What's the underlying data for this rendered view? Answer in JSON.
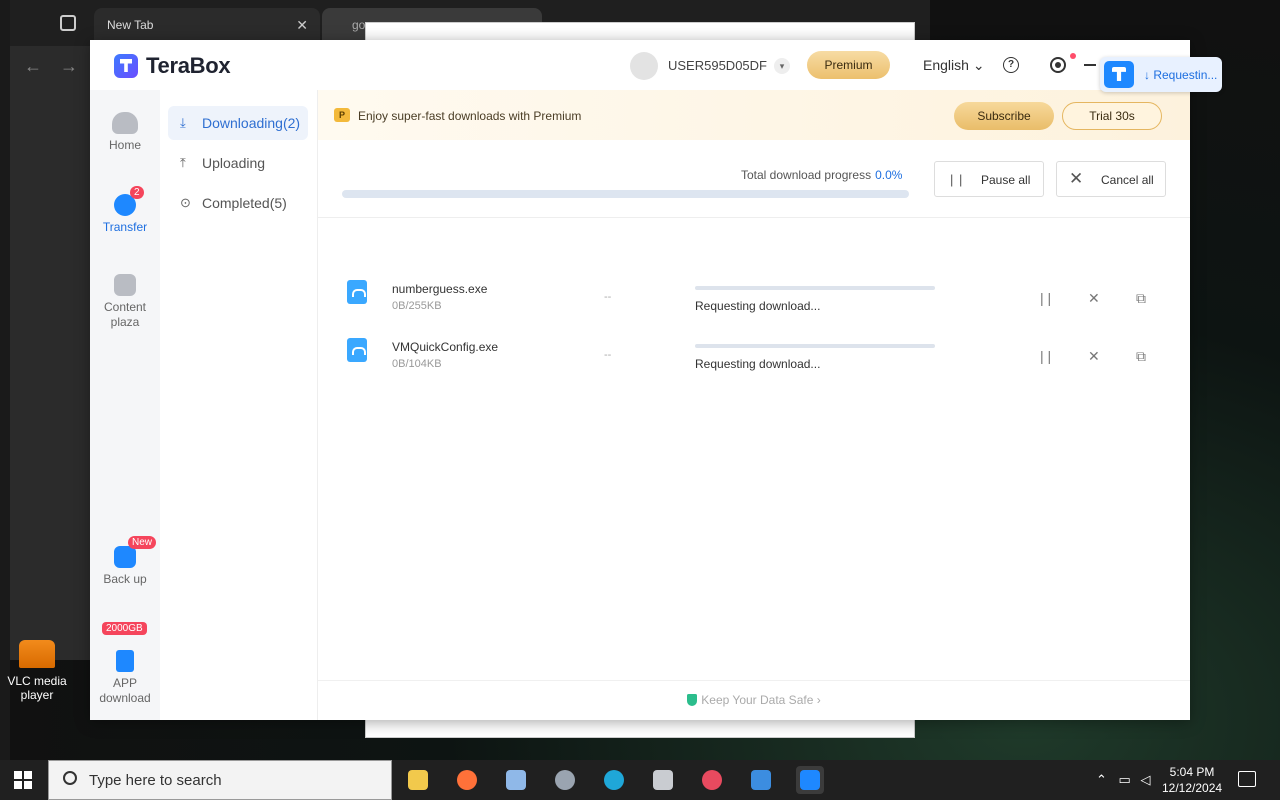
{
  "browser": {
    "tab_title": "New Tab",
    "tab2_title": "go",
    "nav_back": "←",
    "nav_forward": "→"
  },
  "desktop": {
    "vlc_label": "VLC media player"
  },
  "app": {
    "brand": "TeraBox",
    "username": "USER595D05DF",
    "premium_label": "Premium",
    "language": "English",
    "language_chevron": "⌄",
    "help_glyph": "?",
    "float_status": "↓ Requestin..."
  },
  "rail": {
    "items": [
      {
        "label": "Home",
        "icon": "cloud-icon"
      },
      {
        "label": "Transfer",
        "icon": "transfer-icon",
        "badge": "2"
      },
      {
        "label": "Content plaza",
        "icon": "play-icon"
      },
      {
        "label": "Back up",
        "icon": "backup-icon",
        "badge": "New"
      },
      {
        "label": "APP download",
        "icon": "phone-icon",
        "badge": "2000GB"
      }
    ]
  },
  "sidebar": {
    "items": [
      {
        "label": "Downloading(2)",
        "icon": "download-icon",
        "active": true
      },
      {
        "label": "Uploading",
        "icon": "upload-icon"
      },
      {
        "label": "Completed(5)",
        "icon": "check-circle-icon"
      }
    ]
  },
  "promo": {
    "text": "Enjoy super-fast downloads with Premium",
    "subscribe": "Subscribe",
    "trial": "Trial 30s"
  },
  "progress": {
    "label": "Total download progress",
    "value": "0.0%",
    "fraction": 0.0,
    "pause_all": "Pause all",
    "cancel_all": "Cancel all"
  },
  "downloads": [
    {
      "name": "numberguess.exe",
      "size": "0B/255KB",
      "speed": "--",
      "status": "Requesting download...",
      "progress": 0.0
    },
    {
      "name": "VMQuickConfig.exe",
      "size": "0B/104KB",
      "speed": "--",
      "status": "Requesting download...",
      "progress": 0.0
    }
  ],
  "footer": {
    "text": "Keep Your Data Safe"
  },
  "taskbar": {
    "search_placeholder": "Type here to search",
    "time": "5:04 PM",
    "date": "12/12/2024",
    "apps": [
      "file-explorer",
      "firefox",
      "notepad",
      "tools",
      "edge",
      "network",
      "security",
      "photos",
      "terabox"
    ]
  },
  "colors": {
    "accent": "#1e88ff",
    "premium_gold": "#ecc06d",
    "badge_red": "#f5455c"
  }
}
